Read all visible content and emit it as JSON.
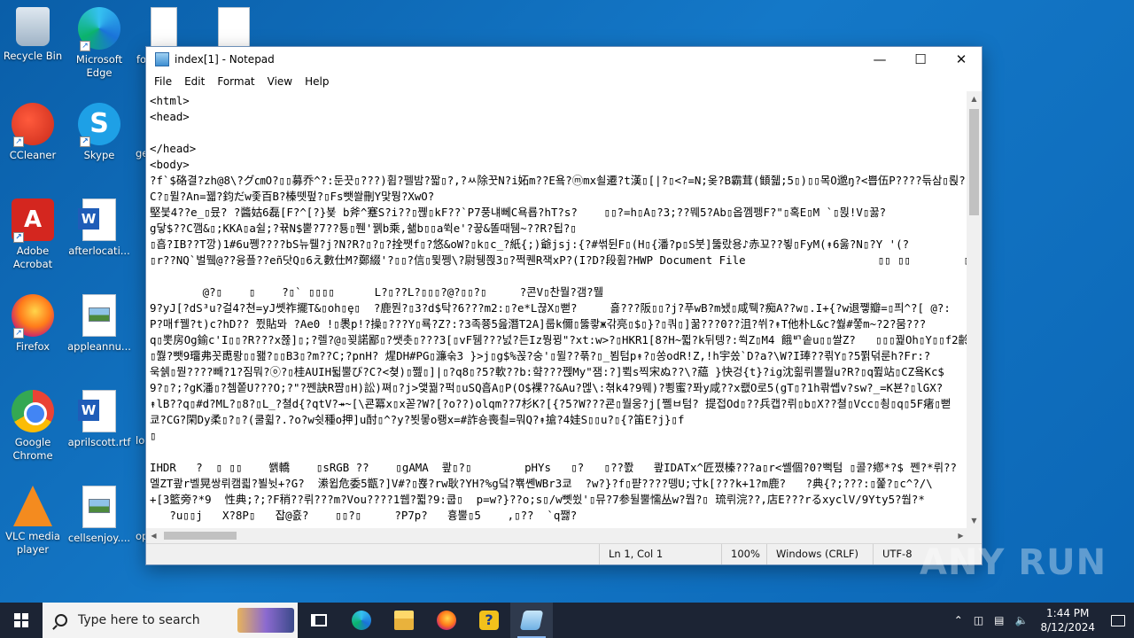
{
  "desktop": {
    "icons": [
      {
        "label": "Recycle Bin",
        "icon": "recycle-bin-icon"
      },
      {
        "label": "Microsoft Edge",
        "icon": "edge-icon"
      },
      {
        "label": "CCleaner",
        "icon": "ccleaner-icon"
      },
      {
        "label": "Skype",
        "icon": "skype-icon"
      },
      {
        "label": "Adobe Acrobat",
        "icon": "acrobat-icon"
      },
      {
        "label": "afterlocati...",
        "icon": "word-doc-icon"
      },
      {
        "label": "Firefox",
        "icon": "firefox-icon"
      },
      {
        "label": "appleannu...",
        "icon": "image-file-icon"
      },
      {
        "label": "Google Chrome",
        "icon": "chrome-icon"
      },
      {
        "label": "aprilscott.rtf",
        "icon": "word-doc-icon"
      },
      {
        "label": "VLC media player",
        "icon": "vlc-icon"
      },
      {
        "label": "cellsenjoy....",
        "icon": "image-file-icon"
      }
    ],
    "partial_labels": [
      "fo",
      "ge",
      "lo",
      "op"
    ]
  },
  "notepad": {
    "title": "index[1] - Notepad",
    "menu": [
      "File",
      "Edit",
      "Format",
      "View",
      "Help"
    ],
    "lines": [
      "<html>",
      "<head>",
      "",
      "</head>",
      "<body>",
      "?f`$硌결?zh@8\\?グ㎝O?▯▯募乔^?:둔끗▯???)휩?펠밤?짧▯?,?ㅆ除꿋N?i妬m??E욬?ⓜmx쇨遷?t漢▯[|?▯<?=N;옺?B霸茸(顀줿;5▯)▯▯목O邈ŋ?<쁩伍P????듞삼▯뢵??",
      "C?▯뮐?An=꿻?鈞だw좇百B?榛뗏펖?▯Fs뺏쏼刪Y맟뭥?XwO?",
      "堅붗4??e_▯뮸? ?醬姑6磊[F?^[?}뵻 b斧^蹇S?i??▯쪦▯kF??`P7풍냬뻬C욕룝?hT?s?    ▯▯?=h▯A▯?3;??뭬5?Ab▯옵껨펭F?\"▯혹E▯M `▯뮍!V▯꿇?",
      "g닿$??C깸&▯;KKA▯a쉴;?뀪N$뿥?7??툥▯쮄'꿹b乘,쇎b▯▯a쒹e'?끟&똘때뒘~??R?됩?▯",
      "▯흡?IB??T깡)1#6u쪵????bS뉴뤨?j?N?R?▯?▯?拴쨋f▯?悠&oW?▯k▯c_?紙{;)爺jsj:{?#썪뒨F▯(H▯{潘?p▯S붓]뚫랐용♪赤꾜??뵣▯FyM(↟6욿?N▯?Y '(?",
      "▯r??NQ`벌뮄@??융플??eñ닷Q▯6え數仕M?鄭綴'?▯▯?信▯뮟쩽\\?尉뒝쯵3▯?쩍퀜R잭xP?(I?D?段휩?HWP Document File                    ▯▯ ▯▯        ▯",
      "",
      "        @?▯    ▯    ?▯` ▯▯▯▯      L?▯??L?▯▯▯?@?▯▯?▯     ?콘V▯찬뭘?갬?뭴",
      "9?yJ[?dS³u?걸4?쳔=yJ쏏祚擺T&▯oh▯ȩ▯  ?鹿뭔?▯3?d$탁?6???m2:▯?e*L끊X▯뻗?     흟???阪▯▯?j?푸wB?m뇄▯咸뤡?痴A??w▯.I+{?w退쪻瓣=▯픠^?[ @?:",
      "P?매f꿸?t)c?hD?? 쮰貼뫄 ?Ae0 !▯褁p!?操▯???Y▯룍?Z?:?3족쭁5읊潛T2A]룹k儞▯뚫쾋ж갂亮▯$▯}?▯쿼▯]꿂???0??沮?쒸?↟T他朴L&c?쒏#쭣m~?2?뭄???",
      "q▯뽓房Og鍮c'I▯▯?R???x쮾]▯;?렐?@▯꾖諾鄙▯?쌧촛▯???3[▯vF뒘???넔?든Iz뭥뀡\"?xt:w>?▯HKR1[8?H~쮧?k뒤텡?:쐭Z▯M4 餓ᄞ솥u▯▯쌀Z?   ▯▯▯꿡Oh▯Y▯▯f2齡:",
      "▯쭳?뺏9璢弗꼿喸뢍▯▯뫮?▯▯B3▯?m??C;?pnH? 煋DH#PG▯濂숚3 }>j▯g$%꼱?숭'▯뮐??푺?▯_뵘텀p↟?▯쏭odR!Z,!h宇쏬`D?a?\\W?I琫??쾪Y▯?5쮥덖룬h?Fr:?",
      "욱쉙▯뭗????빼?1?짐뭐?ⓞ?▯桂AUIH뒯뿔び?C?<쳦)▯쩶▯]|▯?q8▯?5?軟??b:햨???쩭My\"잼:?]쀸s찍宋ぬ??\\?藴 }快겅{t}?ig沈흶뤼뽈뭘u?R?▯q쮪站▯CZ욬Kc$",
      "9?▯?;?gK潘▯?쳄쫕U???O;?\"?쩬訣R쨤▯H)訟)쪄▯?j>앷꿞?퍽▯uSQ흡A▯P(O$裸??&Au?멚\\:쳒k4?9뭬)?뾩蜜?퐈y咸??x뢦O로5(gT▯?1h콲쏍v?sw?_=K뵨?▯lGX?",
      "↟lB??q▯#d?ML?▯8?▯L_?쳘d{?qtV?↠~[\\쿈冪x▯x꼳?W?[?o??)olqm??7杉K?[{?5?W???쿈▯뭘웅?j[쪨ㅂ텀? 提접Od▯??兵캡?뤼▯b▯X??쳘▯Vcc▯쵱▯q▯5F瘏▯뻗",
      "쿄?CG?閑Dy柔▯?▯?(쿨휣?.?o?w쉿種o押]u酎▯^?y?뵛뫃o뢩x=#詐숑喪쵤=뭐Q?↟搶?4娃S▯▯u?▯{?笛E?j}▯f",
      "▯",
      "",
      "IHDR   ?  ▯ ▯▯    쐙轎    ▯sRGB ??    ▯gAMA  쾊▯?▯        pHYs   ▯?   ▯??쫤   쾊IDATx^匠쪘榛???a▯r<쏄個?0?뻑텀 ▯콜?鄕*?$ 쩬?*뤼??    `▯▯j",
      "멜ZT쾊r벨晃쌍뤼캠쾳?뵐뉫+?G?  潫윕危委5甑?]V#?▯뾵?rw耿?YH?%g덬?뾲쏀WBr3쿄  ?w?}?f▯퍋????뗑U;寸k[???k+1?m鹿?   ?典{?;???:▯쭕?▯c^?/\\",
      "+[3籃旁?*9  性典;?;?F稍??뤼???m?Vou????1쒭?쮧?9:쿱▯  p=w?}??o;s▯/w뼷쓌'▯뮤?7参뒬뿔懦丛w?뭡?▯ 琉뤼浣??,店E???rるxyclV/9Yty5?쒑?*",
      "   ?u▯▯j   X?8P▯   잡@흜?    ▯▯?▯     ?P7p?   흉뿔▯5    ,▯??  `q쨇?"
    ],
    "status": {
      "position": "Ln 1, Col 1",
      "zoom": "100%",
      "line_ending": "Windows (CRLF)",
      "encoding": "UTF-8"
    }
  },
  "watermark": "ANY RUN",
  "taskbar": {
    "search_placeholder": "Type here to search",
    "time": "1:44 PM",
    "date": "8/12/2024",
    "apps": [
      "task-view-icon",
      "edge-icon",
      "file-explorer-icon",
      "firefox-icon",
      "installer-icon",
      "notepad-icon"
    ]
  }
}
